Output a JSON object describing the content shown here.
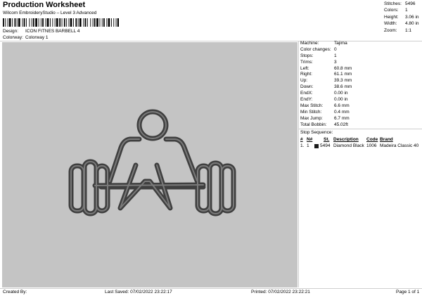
{
  "header": {
    "title": "Production Worksheet",
    "subtitle": "Wilcom EmbroideryStudio – Level 3 Advanced"
  },
  "meta": {
    "design_label": "Design:",
    "design_value": "ICON FITNES BARBELL 4",
    "colorway_label": "Colorway:",
    "colorway_value": "Colorway 1"
  },
  "summary": [
    {
      "label": "Stitches:",
      "value": "5496"
    },
    {
      "label": "Colors:",
      "value": "1"
    },
    {
      "label": "Height:",
      "value": "3.06 in"
    },
    {
      "label": "Width:",
      "value": "4.80 in"
    },
    {
      "label": "Zoom:",
      "value": "1:1"
    }
  ],
  "details": [
    {
      "label": "Machine:",
      "value": "Tajima"
    },
    {
      "label": "Color changes:",
      "value": "0"
    },
    {
      "label": "Stops:",
      "value": "1"
    },
    {
      "label": "Trims:",
      "value": "3"
    },
    {
      "label": "Left:",
      "value": "60.8 mm"
    },
    {
      "label": "Right:",
      "value": "61.1 mm"
    },
    {
      "label": "Up:",
      "value": "39.3 mm"
    },
    {
      "label": "Down:",
      "value": "38.6 mm"
    },
    {
      "label": "EndX:",
      "value": "0.00 in"
    },
    {
      "label": "EndY:",
      "value": "0.00 in"
    },
    {
      "label": "Max Stitch:",
      "value": "6.6 mm"
    },
    {
      "label": "Min Stitch:",
      "value": "0.4 mm"
    },
    {
      "label": "Max Jump:",
      "value": "6.7 mm"
    },
    {
      "label": "Total Bobbin:",
      "value": "45.02ft"
    }
  ],
  "stop_sequence": {
    "title": "Stop Sequence:",
    "headers": {
      "num": "#",
      "n": "N#",
      "st": "St.",
      "description": "Description",
      "code": "Code",
      "brand": "Brand"
    },
    "rows": [
      {
        "num": "1.",
        "n": "1",
        "swatch_color": "#1a1a1a",
        "st": "5494",
        "description": "Diamond Black",
        "code": "1006",
        "brand": "Madeira Classic 40"
      }
    ]
  },
  "footer": {
    "created_by": "Created By:",
    "last_saved": "Last Saved: 07/02/2022 23:22:17",
    "printed": "Printed: 07/02/2022 23:22:21",
    "page": "Page 1 of 1"
  },
  "colors": {
    "background_area": "#c4c4c4",
    "thread": "#4a4a4a",
    "thread_highlight": "#6e6e6e"
  },
  "icons": {
    "design": "barbell-lifter-embroidery"
  }
}
